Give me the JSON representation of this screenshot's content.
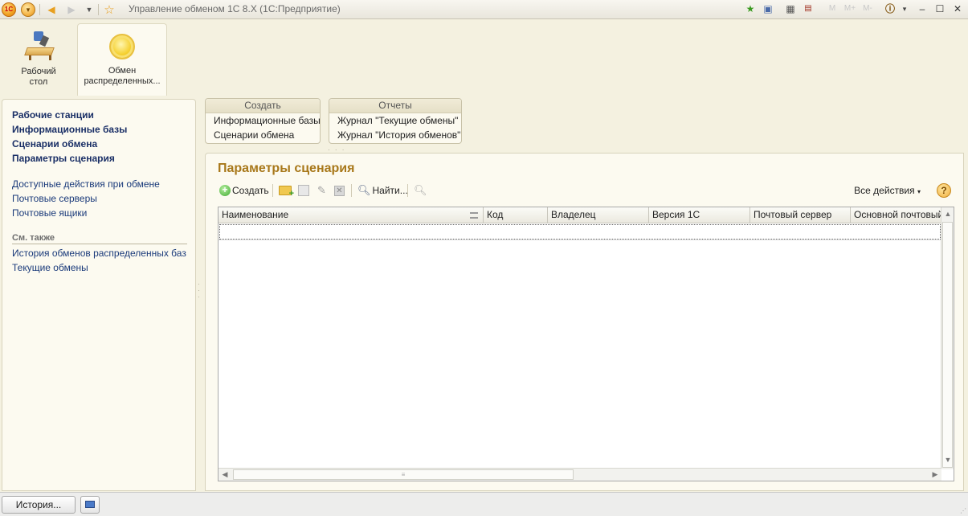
{
  "titlebar": {
    "title": "Управление обменом 1С 8.X  (1С:Предприятие)",
    "logo_text": "1С"
  },
  "sections": [
    {
      "label": "Рабочий стол",
      "icon": "desk-icon"
    },
    {
      "label": "Обмен распределенных...",
      "icon": "coin-icon"
    }
  ],
  "left_panel": {
    "main_links": [
      "Рабочие станции",
      "Информационные базы",
      "Сценарии обмена",
      "Параметры сценария"
    ],
    "secondary_links": [
      "Доступные действия при обмене",
      "Почтовые серверы",
      "Почтовые ящики"
    ],
    "see_also_title": "См. также",
    "see_also_links": [
      "История обменов распределенных баз",
      "Текущие обмены"
    ]
  },
  "command_groups": [
    {
      "title": "Создать",
      "items": [
        "Информационные базы",
        "Сценарии обмена"
      ]
    },
    {
      "title": "Отчеты",
      "items": [
        "Журнал \"Текущие обмены\"",
        "Журнал \"История обменов\""
      ]
    }
  ],
  "form": {
    "title": "Параметры сценария",
    "toolbar": {
      "create_label": "Создать",
      "find_label": "Найти...",
      "all_actions_label": "Все действия",
      "help_label": "?"
    },
    "table": {
      "columns": [
        "Наименование",
        "Код",
        "Владелец",
        "Версия 1С",
        "Почтовый сервер",
        "Основной почтовый ..."
      ]
    }
  },
  "statusbar": {
    "history_label": "История..."
  }
}
